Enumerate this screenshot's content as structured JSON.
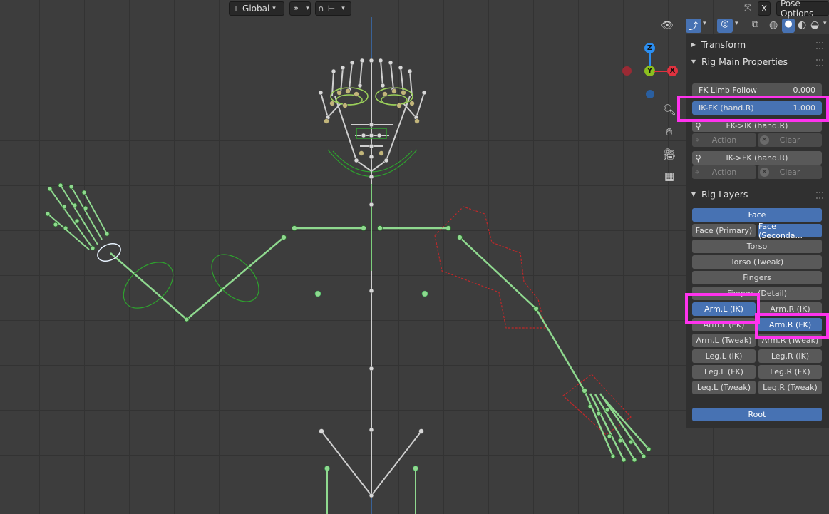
{
  "header": {
    "orientation": "Global",
    "snap_icon": "link-icon",
    "proportional_icon": "magnet-icon",
    "snap_mode_icon": "snap-icon",
    "pose_options_x": "X",
    "pose_options": "Pose Options"
  },
  "viewport_icons": {
    "zoom": "zoom-icon",
    "pan": "hand-icon",
    "camera": "camera-icon",
    "grid": "grid-icon"
  },
  "gizmo": {
    "z": "Z",
    "y": "Y",
    "x": "X"
  },
  "panel": {
    "transform_title": "Transform",
    "rig_main_title": "Rig Main Properties",
    "fk_limb_follow": {
      "label": "FK Limb Follow",
      "value": "0.000"
    },
    "ik_fk_hand": {
      "label": "IK-FK (hand.R)",
      "value": "1.000"
    },
    "fk_to_ik": "FK->IK (hand.R)",
    "ik_to_fk": "IK->FK (hand.R)",
    "action_label": "Action",
    "clear_label": "Clear",
    "rig_layers_title": "Rig Layers",
    "layers": {
      "face": "Face",
      "face_primary": "Face (Primary)",
      "face_secondary": "Face (Seconda...",
      "torso": "Torso",
      "torso_tweak": "Torso (Tweak)",
      "fingers": "Fingers",
      "fingers_detail": "Fingers (Detail)",
      "arm_l_ik": "Arm.L (IK)",
      "arm_r_ik": "Arm.R (IK)",
      "arm_l_fk": "Arm.L (FK)",
      "arm_r_fk": "Arm.R (FK)",
      "arm_l_tweak": "Arm.L (Tweak)",
      "arm_r_tweak": "Arm.R (Tweak)",
      "leg_l_ik": "Leg.L (IK)",
      "leg_r_ik": "Leg.R (IK)",
      "leg_l_fk": "Leg.L (FK)",
      "leg_r_fk": "Leg.R (FK)",
      "leg_l_tweak": "Leg.L (Tweak)",
      "leg_r_tweak": "Leg.R (Tweak)",
      "root": "Root"
    }
  },
  "colors": {
    "active_layer": "#4772b3",
    "highlight": "#ff33ee",
    "bone_selected": "#8fd98f",
    "bone_default": "#c8c8c8",
    "ik_widget_red": "#c0282a",
    "axis_x": "#e0323f",
    "axis_y": "#8cbf1f",
    "axis_z": "#2b8ef0"
  }
}
